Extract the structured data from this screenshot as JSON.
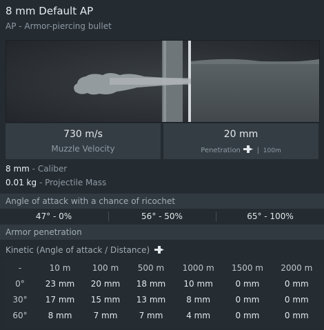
{
  "header": {
    "title": "8 mm Default AP",
    "subtitle": "AP - Armor-piercing bullet"
  },
  "stats": {
    "velocity_value": "730 m/s",
    "velocity_label": "Muzzle Velocity",
    "penetration_value": "20 mm",
    "penetration_label": "Penetration",
    "penetration_distance": "100m"
  },
  "info": {
    "caliber_value": "8 mm",
    "caliber_label": "Caliber",
    "mass_value": "0.01 kg",
    "mass_label": "Projectile Mass"
  },
  "ricochet": {
    "heading": "Angle of attack with a chance of ricochet",
    "values": [
      "47° - 0%",
      "56° - 50%",
      "65° - 100%"
    ]
  },
  "penetration_section": {
    "heading": "Armor penetration",
    "kinetic_label": "Kinetic (Angle of attack / Distance)"
  },
  "table": {
    "corner": "-",
    "columns": [
      "10 m",
      "100 m",
      "500 m",
      "1000 m",
      "1500 m",
      "2000 m"
    ],
    "rows": [
      {
        "angle": "0°",
        "values": [
          "23 mm",
          "20 mm",
          "18 mm",
          "10 mm",
          "0 mm",
          "0 mm"
        ]
      },
      {
        "angle": "30°",
        "values": [
          "17 mm",
          "15 mm",
          "13 mm",
          "8 mm",
          "0 mm",
          "0 mm"
        ]
      },
      {
        "angle": "60°",
        "values": [
          "8 mm",
          "7 mm",
          "7 mm",
          "4 mm",
          "0 mm",
          "0 mm"
        ]
      }
    ]
  },
  "icons": [
    "penetration-icon",
    "penetration-icon"
  ],
  "colors": {
    "background": "#242b31",
    "panel": "#343d44",
    "section": "#323a41"
  }
}
